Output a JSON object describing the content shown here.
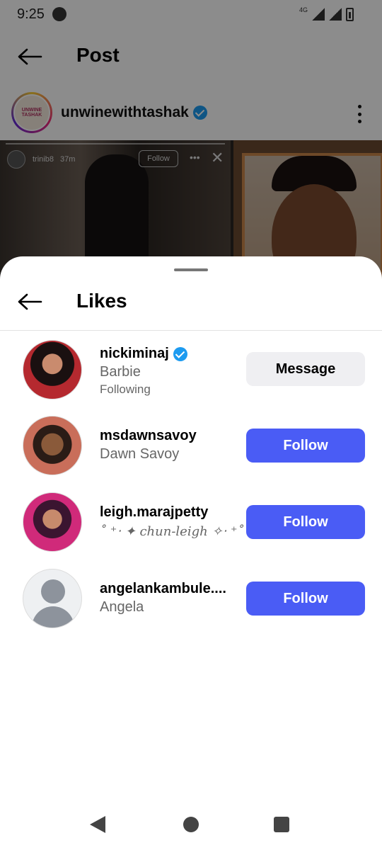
{
  "status_bar": {
    "time": "9:25",
    "network": "4G"
  },
  "post_header": {
    "title": "Post"
  },
  "post": {
    "account": "unwinewithtashak",
    "verified": true,
    "avatar_text": "UNWINE TASHAK",
    "story_overlay": {
      "user": "trinib8",
      "age": "37m",
      "follow_label": "Follow"
    }
  },
  "likes_sheet": {
    "title": "Likes",
    "users": [
      {
        "username": "nickiminaj",
        "verified": true,
        "fullname": "Barbie",
        "subtext": "Following",
        "button": "Message",
        "button_style": "message"
      },
      {
        "username": "msdawnsavoy",
        "verified": false,
        "fullname": "Dawn Savoy",
        "button": "Follow",
        "button_style": "follow"
      },
      {
        "username": "leigh.marajpetty",
        "verified": false,
        "fullname": "˚ ⁺‧ ✦ chun-leigh ✧‧ ⁺˚",
        "button": "Follow",
        "button_style": "follow"
      },
      {
        "username": "angelankambule....",
        "verified": false,
        "fullname": "Angela",
        "button": "Follow",
        "button_style": "follow"
      }
    ]
  },
  "colors": {
    "follow_button": "#4a5cf5",
    "message_button": "#efeff2",
    "verified_badge": "#1d9bf0"
  },
  "icons": [
    "back-arrow-icon",
    "verified-icon",
    "more-vertical-icon",
    "close-icon",
    "nav-back-icon",
    "nav-home-icon",
    "nav-recent-icon",
    "phone-icon",
    "signal-icon",
    "battery-icon"
  ]
}
